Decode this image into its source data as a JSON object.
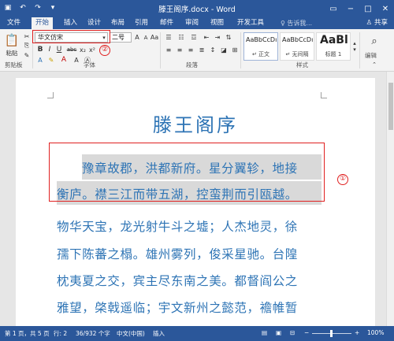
{
  "window": {
    "title": "滕王阁序.docx - Word"
  },
  "tabs": [
    {
      "label": "文件"
    },
    {
      "label": "开始"
    },
    {
      "label": "插入"
    },
    {
      "label": "设计"
    },
    {
      "label": "布局"
    },
    {
      "label": "引用"
    },
    {
      "label": "邮件"
    },
    {
      "label": "审阅"
    },
    {
      "label": "视图"
    },
    {
      "label": "开发工具"
    }
  ],
  "tell_me": "♀ 告诉我...",
  "share": "♙ 共享",
  "ribbon": {
    "paste_label": "粘贴",
    "font_name": "华文仿宋",
    "font_size": "二号",
    "groups": {
      "clipboard": "剪贴板",
      "font": "字体",
      "paragraph": "段落",
      "styles": "样式",
      "editing": "编辑"
    },
    "styles": [
      {
        "sample": "AaBbCcDı",
        "name": "↵ 正文"
      },
      {
        "sample": "AaBbCcDı",
        "name": "↵ 无间隔"
      },
      {
        "sample": "AaBl",
        "name": "标题 1"
      }
    ],
    "bold": "B",
    "italic": "I",
    "underline": "U",
    "strike": "abc",
    "sub": "x₂",
    "sup": "x²",
    "font_color": "A"
  },
  "annotations": {
    "marker_1": "①",
    "marker_2": "②"
  },
  "document": {
    "heading": "滕王阁序",
    "lines": [
      "豫章故郡，洪都新府。星分翼轸，地接",
      "衡庐。襟三江而带五湖，控蛮荆而引瓯越。",
      "物华天宝，龙光射牛斗之墟；人杰地灵，徐",
      "孺下陈蕃之榻。雄州雾列，俊采星驰。台隍",
      "枕夷夏之交，宾主尽东南之美。都督阎公之",
      "雅望，棨戟遥临；宇文新州之懿范，襜帷暂"
    ]
  },
  "status": {
    "page": "第 1 页，共 5 页",
    "line": "行: 2",
    "words": "36/932 个字",
    "lang": "中文(中国)",
    "mode": "插入",
    "zoom": "100%"
  }
}
